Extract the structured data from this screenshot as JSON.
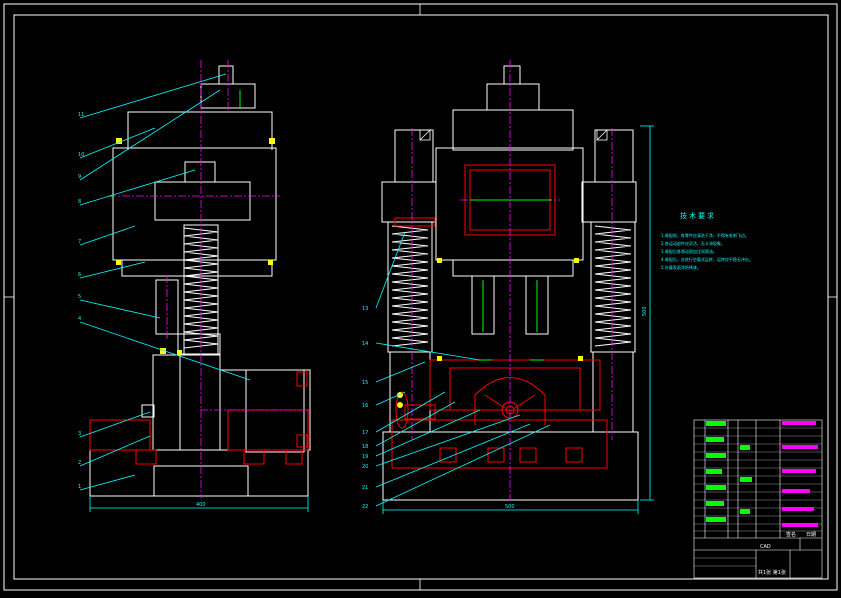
{
  "drawing": {
    "notes_title": "技术要求",
    "notes": [
      "1.装配前，各零件应清洗干净，不得有毛刺飞边。",
      "2.各运动部件应灵活，无卡滞现象。",
      "3.装配后各滑动面加注润滑油。",
      "4.装配后，应进行空载试运转，运转应平稳无冲击。",
      "5.外露表面涂防锈漆。"
    ],
    "left_labels": [
      "11",
      "10",
      "9",
      "8",
      "7",
      "6",
      "5",
      "4",
      "3",
      "2",
      "1"
    ],
    "right_labels": [
      "13",
      "14",
      "15",
      "16",
      "17",
      "18",
      "19",
      "20",
      "21",
      "22"
    ],
    "overall_height": "500",
    "left_width": "400",
    "right_width": "500",
    "title_block": {
      "title": "CAD",
      "sign_label": "签名",
      "date_label": "日期",
      "sheet": "共1张 第1张"
    },
    "colors": {
      "outline": "#ffffff",
      "centerline": "#ff00ff",
      "leader": "#00ffff",
      "red": "#ff0000",
      "green": "#00ff00",
      "yellow": "#ffff00"
    }
  }
}
